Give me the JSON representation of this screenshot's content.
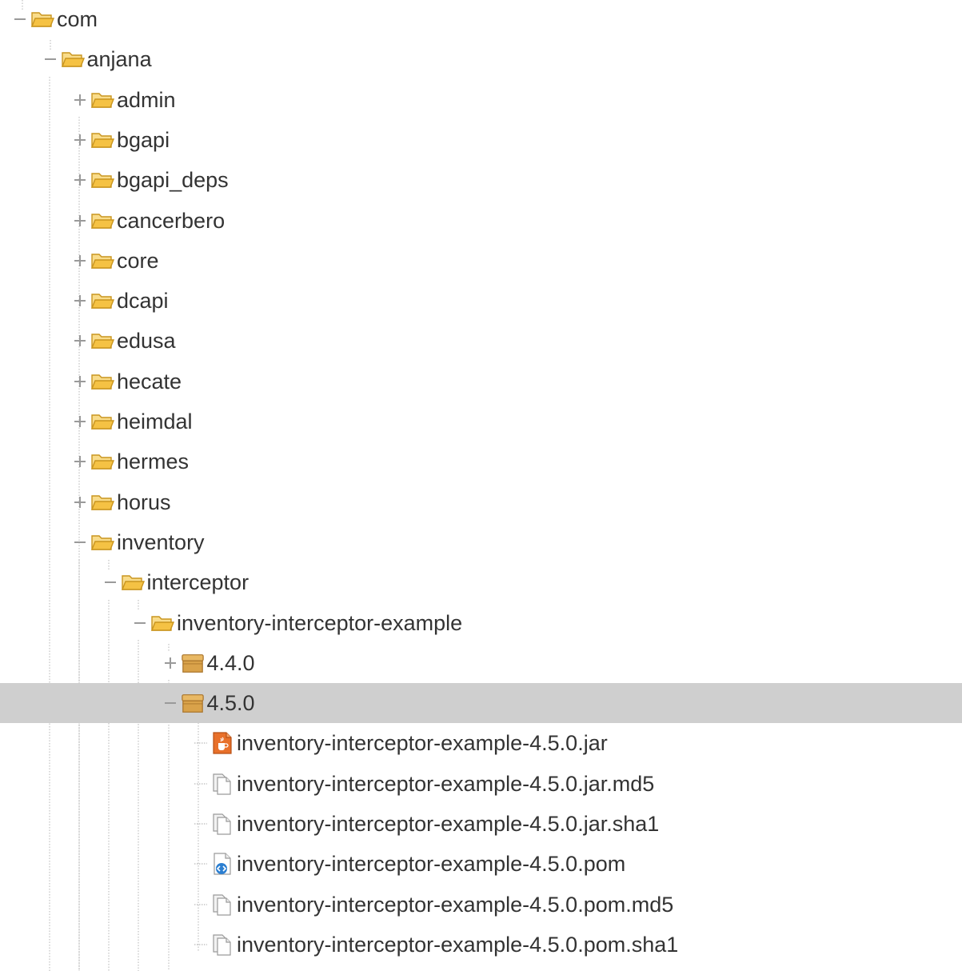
{
  "colors": {
    "selected_row": "#cfcfcf",
    "folder": "#f5c244",
    "version": "#d9a24a",
    "jar": "#e8702a",
    "pom_badge": "#2c7fd1",
    "text": "#333333"
  },
  "tree": [
    {
      "label": "com",
      "depth": 0,
      "toggle": "collapse",
      "icon": "folder-open-icon",
      "name": "com"
    },
    {
      "label": "anjana",
      "depth": 1,
      "toggle": "collapse",
      "icon": "folder-open-icon",
      "name": "anjana"
    },
    {
      "label": "admin",
      "depth": 2,
      "toggle": "expand",
      "icon": "folder-open-icon",
      "name": "admin"
    },
    {
      "label": "bgapi",
      "depth": 2,
      "toggle": "expand",
      "icon": "folder-open-icon",
      "name": "bgapi"
    },
    {
      "label": "bgapi_deps",
      "depth": 2,
      "toggle": "expand",
      "icon": "folder-open-icon",
      "name": "bgapi-deps"
    },
    {
      "label": "cancerbero",
      "depth": 2,
      "toggle": "expand",
      "icon": "folder-open-icon",
      "name": "cancerbero"
    },
    {
      "label": "core",
      "depth": 2,
      "toggle": "expand",
      "icon": "folder-open-icon",
      "name": "core"
    },
    {
      "label": "dcapi",
      "depth": 2,
      "toggle": "expand",
      "icon": "folder-open-icon",
      "name": "dcapi"
    },
    {
      "label": "edusa",
      "depth": 2,
      "toggle": "expand",
      "icon": "folder-open-icon",
      "name": "edusa"
    },
    {
      "label": "hecate",
      "depth": 2,
      "toggle": "expand",
      "icon": "folder-open-icon",
      "name": "hecate"
    },
    {
      "label": "heimdal",
      "depth": 2,
      "toggle": "expand",
      "icon": "folder-open-icon",
      "name": "heimdal"
    },
    {
      "label": "hermes",
      "depth": 2,
      "toggle": "expand",
      "icon": "folder-open-icon",
      "name": "hermes"
    },
    {
      "label": "horus",
      "depth": 2,
      "toggle": "expand",
      "icon": "folder-open-icon",
      "name": "horus"
    },
    {
      "label": "inventory",
      "depth": 2,
      "toggle": "collapse",
      "icon": "folder-open-icon",
      "name": "inventory"
    },
    {
      "label": "interceptor",
      "depth": 3,
      "toggle": "collapse",
      "icon": "folder-open-icon",
      "name": "interceptor"
    },
    {
      "label": "inventory-interceptor-example",
      "depth": 4,
      "toggle": "collapse",
      "icon": "folder-open-icon",
      "name": "inventory-interceptor-example"
    },
    {
      "label": "4.4.0",
      "depth": 5,
      "toggle": "expand",
      "icon": "version-box-icon",
      "name": "version-4-4-0"
    },
    {
      "label": "4.5.0",
      "depth": 5,
      "toggle": "collapse",
      "icon": "version-box-icon",
      "name": "version-4-5-0",
      "selected": true
    },
    {
      "label": "inventory-interceptor-example-4.5.0.jar",
      "depth": 6,
      "toggle": "leaf",
      "icon": "jar-file-icon",
      "name": "file-jar"
    },
    {
      "label": "inventory-interceptor-example-4.5.0.jar.md5",
      "depth": 6,
      "toggle": "leaf",
      "icon": "checksum-file-icon",
      "name": "file-jar-md5"
    },
    {
      "label": "inventory-interceptor-example-4.5.0.jar.sha1",
      "depth": 6,
      "toggle": "leaf",
      "icon": "checksum-file-icon",
      "name": "file-jar-sha1"
    },
    {
      "label": "inventory-interceptor-example-4.5.0.pom",
      "depth": 6,
      "toggle": "leaf",
      "icon": "pom-file-icon",
      "name": "file-pom"
    },
    {
      "label": "inventory-interceptor-example-4.5.0.pom.md5",
      "depth": 6,
      "toggle": "leaf",
      "icon": "checksum-file-icon",
      "name": "file-pom-md5"
    },
    {
      "label": "inventory-interceptor-example-4.5.0.pom.sha1",
      "depth": 6,
      "toggle": "leaf",
      "icon": "checksum-file-icon",
      "name": "file-pom-sha1",
      "last": true
    }
  ]
}
